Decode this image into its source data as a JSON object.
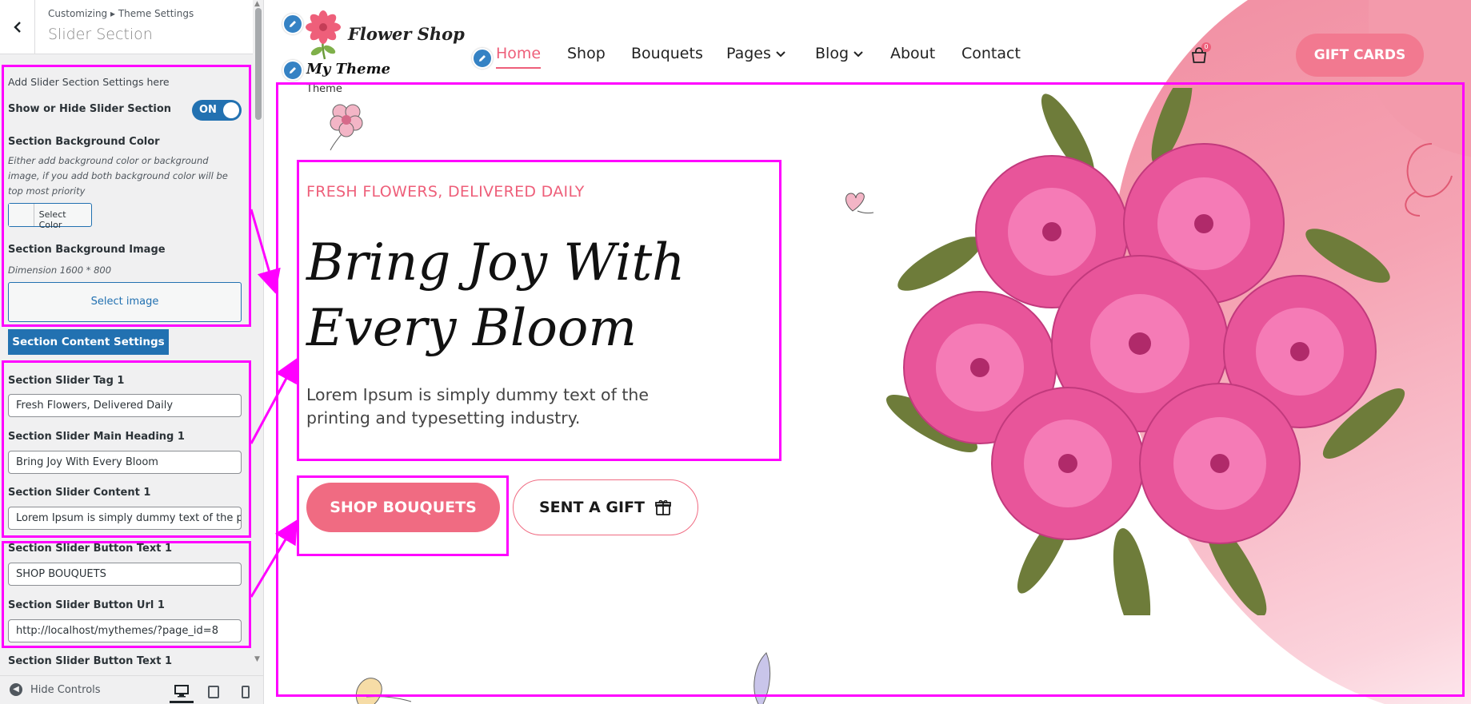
{
  "customizer": {
    "breadcrumb": "Customizing ▸ Theme Settings",
    "title": "Slider Section",
    "intro": "Add Slider Section Settings here",
    "show_hide_label": "Show or Hide Slider Section",
    "toggle_state": "ON",
    "bg_color_label": "Section Background Color",
    "bg_color_desc": "Either add background color or background image, if you add both background color will be top most priority",
    "select_color": "Select Color",
    "bg_image_label": "Section Background Image",
    "bg_image_desc": "Dimension 1600 * 800",
    "select_image": "Select image",
    "content_settings": "Section Content Settings",
    "tag_label": "Section Slider Tag 1",
    "tag_value": "Fresh Flowers, Delivered Daily",
    "heading_label": "Section Slider Main Heading 1",
    "heading_value": "Bring Joy With Every Bloom",
    "content_label": "Section Slider Content 1",
    "content_value": "Lorem Ipsum is simply dummy text of the printing and typesetting industry.",
    "button_text_label": "Section Slider Button Text 1",
    "button_text_value": "SHOP BOUQUETS",
    "button_url_label": "Section Slider Button Url 1",
    "button_url_value": "http://localhost/mythemes/?page_id=8",
    "button_text_label_2": "Section Slider Button Text 1",
    "hide_controls": "Hide Controls"
  },
  "site": {
    "logo_text": "Flower Shop",
    "site_title": "My Theme",
    "tagline": "Theme",
    "cart_count": "0",
    "gift_cards": "GIFT CARDS",
    "nav": [
      "Home",
      "Shop",
      "Bouquets",
      "Pages",
      "Blog",
      "About",
      "Contact"
    ]
  },
  "slider": {
    "tag": "FRESH FLOWERS, DELIVERED DAILY",
    "heading": "Bring Joy With Every Bloom",
    "text": "Lorem Ipsum is simply dummy text of the printing and typesetting industry.",
    "primary_button": "SHOP BOUQUETS",
    "secondary_button": "SENT A GIFT"
  },
  "colors": {
    "accent": "#ee5f7a",
    "highlight": "#ff00ff",
    "wp_blue": "#2271b1"
  }
}
